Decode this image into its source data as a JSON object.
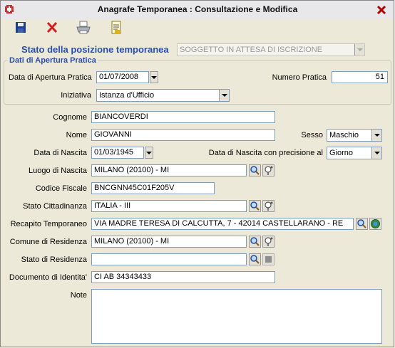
{
  "window": {
    "title": "Anagrafe Temporanea : Consultazione e Modifica"
  },
  "toolbar": {
    "save_icon": "floppy-disk-icon",
    "delete_icon": "red-x-icon",
    "print_icon": "printer-icon",
    "report_icon": "document-icon"
  },
  "stato": {
    "label": "Stato della posizione temporanea",
    "value": "SOGGETTO IN ATTESA DI ISCRIZIONE"
  },
  "apertura": {
    "legend": "Dati di Apertura Pratica",
    "data_label": "Data di Apertura Pratica",
    "data_value": "01/07/2008",
    "numero_label": "Numero Pratica",
    "numero_value": "51",
    "iniziativa_label": "Iniziativa",
    "iniziativa_value": "Istanza d'Ufficio"
  },
  "anagrafica": {
    "cognome_label": "Cognome",
    "cognome_value": "BIANCOVERDI",
    "nome_label": "Nome",
    "nome_value": "GIOVANNI",
    "sesso_label": "Sesso",
    "sesso_value": "Maschio",
    "data_nascita_label": "Data di Nascita",
    "data_nascita_value": "01/03/1945",
    "precisione_label": "Data di Nascita con precisione al",
    "precisione_value": "Giorno",
    "luogo_label": "Luogo di Nascita",
    "luogo_value": "MILANO (20100) - MI",
    "cf_label": "Codice Fiscale",
    "cf_value": "BNCGNN45C01F205V",
    "cittadinanza_label": "Stato Cittadinanza",
    "cittadinanza_value": "ITALIA - III",
    "recapito_label": "Recapito Temporaneo",
    "recapito_value": "VIA MADRE TERESA DI CALCUTTA, 7 - 42014 CASTELLARANO - RE",
    "comune_res_label": "Comune di Residenza",
    "comune_res_value": "MILANO (20100) - MI",
    "stato_res_label": "Stato di Residenza",
    "stato_res_value": "",
    "documento_label": "Documento di Identita'",
    "documento_value": "CI AB 34343433",
    "note_label": "Note",
    "note_value": ""
  },
  "colors": {
    "accent": "#2A4DB0",
    "background": "#ECE9D8",
    "border": "#7F9DB9"
  }
}
